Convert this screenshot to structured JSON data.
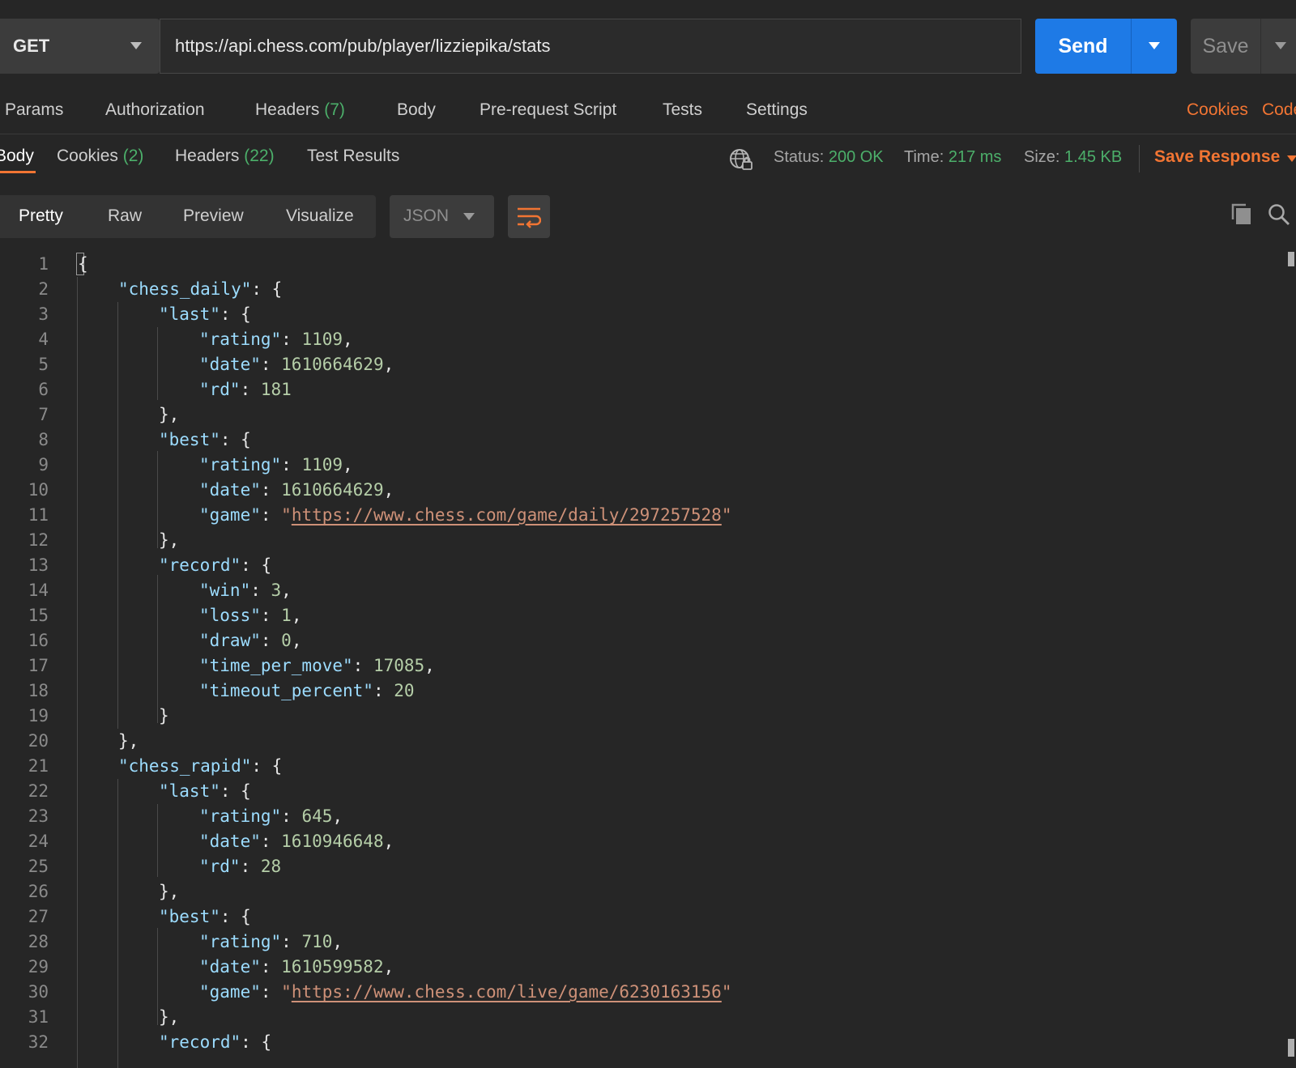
{
  "request": {
    "method": "GET",
    "url": "https://api.chess.com/pub/player/lizziepika/stats",
    "send_label": "Send",
    "save_label": "Save"
  },
  "request_tabs": {
    "params": "Params",
    "authorization": "Authorization",
    "headers": "Headers",
    "headers_count": "(7)",
    "body": "Body",
    "prerequest": "Pre-request Script",
    "tests": "Tests",
    "settings": "Settings",
    "cookies": "Cookies",
    "code": "Code"
  },
  "response_tabs": {
    "body": "Body",
    "cookies": "Cookies",
    "cookies_count": "(2)",
    "headers": "Headers",
    "headers_count": "(22)",
    "test_results": "Test Results"
  },
  "response_meta": {
    "status_label": "Status:",
    "status_value": "200 OK",
    "time_label": "Time:",
    "time_value": "217 ms",
    "size_label": "Size:",
    "size_value": "1.45 KB",
    "save_response": "Save Response"
  },
  "view": {
    "pretty": "Pretty",
    "raw": "Raw",
    "preview": "Preview",
    "visualize": "Visualize",
    "format": "JSON"
  },
  "code_lines": [
    {
      "n": "1",
      "indent": 0,
      "parts": [
        [
          "p",
          "{"
        ]
      ]
    },
    {
      "n": "2",
      "indent": 1,
      "parts": [
        [
          "k",
          "\"chess_daily\""
        ],
        [
          "p",
          ": {"
        ]
      ]
    },
    {
      "n": "3",
      "indent": 2,
      "parts": [
        [
          "k",
          "\"last\""
        ],
        [
          "p",
          ": {"
        ]
      ]
    },
    {
      "n": "4",
      "indent": 3,
      "parts": [
        [
          "k",
          "\"rating\""
        ],
        [
          "p",
          ": "
        ],
        [
          "n",
          "1109"
        ],
        [
          "p",
          ","
        ]
      ]
    },
    {
      "n": "5",
      "indent": 3,
      "parts": [
        [
          "k",
          "\"date\""
        ],
        [
          "p",
          ": "
        ],
        [
          "n",
          "1610664629"
        ],
        [
          "p",
          ","
        ]
      ]
    },
    {
      "n": "6",
      "indent": 3,
      "parts": [
        [
          "k",
          "\"rd\""
        ],
        [
          "p",
          ": "
        ],
        [
          "n",
          "181"
        ]
      ]
    },
    {
      "n": "7",
      "indent": 2,
      "parts": [
        [
          "p",
          "},"
        ]
      ]
    },
    {
      "n": "8",
      "indent": 2,
      "parts": [
        [
          "k",
          "\"best\""
        ],
        [
          "p",
          ": {"
        ]
      ]
    },
    {
      "n": "9",
      "indent": 3,
      "parts": [
        [
          "k",
          "\"rating\""
        ],
        [
          "p",
          ": "
        ],
        [
          "n",
          "1109"
        ],
        [
          "p",
          ","
        ]
      ]
    },
    {
      "n": "10",
      "indent": 3,
      "parts": [
        [
          "k",
          "\"date\""
        ],
        [
          "p",
          ": "
        ],
        [
          "n",
          "1610664629"
        ],
        [
          "p",
          ","
        ]
      ]
    },
    {
      "n": "11",
      "indent": 3,
      "parts": [
        [
          "k",
          "\"game\""
        ],
        [
          "p",
          ": "
        ],
        [
          "s",
          "\""
        ],
        [
          "u",
          "https://www.chess.com/game/daily/297257528"
        ],
        [
          "s",
          "\""
        ]
      ]
    },
    {
      "n": "12",
      "indent": 2,
      "parts": [
        [
          "p",
          "},"
        ]
      ]
    },
    {
      "n": "13",
      "indent": 2,
      "parts": [
        [
          "k",
          "\"record\""
        ],
        [
          "p",
          ": {"
        ]
      ]
    },
    {
      "n": "14",
      "indent": 3,
      "parts": [
        [
          "k",
          "\"win\""
        ],
        [
          "p",
          ": "
        ],
        [
          "n",
          "3"
        ],
        [
          "p",
          ","
        ]
      ]
    },
    {
      "n": "15",
      "indent": 3,
      "parts": [
        [
          "k",
          "\"loss\""
        ],
        [
          "p",
          ": "
        ],
        [
          "n",
          "1"
        ],
        [
          "p",
          ","
        ]
      ]
    },
    {
      "n": "16",
      "indent": 3,
      "parts": [
        [
          "k",
          "\"draw\""
        ],
        [
          "p",
          ": "
        ],
        [
          "n",
          "0"
        ],
        [
          "p",
          ","
        ]
      ]
    },
    {
      "n": "17",
      "indent": 3,
      "parts": [
        [
          "k",
          "\"time_per_move\""
        ],
        [
          "p",
          ": "
        ],
        [
          "n",
          "17085"
        ],
        [
          "p",
          ","
        ]
      ]
    },
    {
      "n": "18",
      "indent": 3,
      "parts": [
        [
          "k",
          "\"timeout_percent\""
        ],
        [
          "p",
          ": "
        ],
        [
          "n",
          "20"
        ]
      ]
    },
    {
      "n": "19",
      "indent": 2,
      "parts": [
        [
          "p",
          "}"
        ]
      ]
    },
    {
      "n": "20",
      "indent": 1,
      "parts": [
        [
          "p",
          "},"
        ]
      ]
    },
    {
      "n": "21",
      "indent": 1,
      "parts": [
        [
          "k",
          "\"chess_rapid\""
        ],
        [
          "p",
          ": {"
        ]
      ]
    },
    {
      "n": "22",
      "indent": 2,
      "parts": [
        [
          "k",
          "\"last\""
        ],
        [
          "p",
          ": {"
        ]
      ]
    },
    {
      "n": "23",
      "indent": 3,
      "parts": [
        [
          "k",
          "\"rating\""
        ],
        [
          "p",
          ": "
        ],
        [
          "n",
          "645"
        ],
        [
          "p",
          ","
        ]
      ]
    },
    {
      "n": "24",
      "indent": 3,
      "parts": [
        [
          "k",
          "\"date\""
        ],
        [
          "p",
          ": "
        ],
        [
          "n",
          "1610946648"
        ],
        [
          "p",
          ","
        ]
      ]
    },
    {
      "n": "25",
      "indent": 3,
      "parts": [
        [
          "k",
          "\"rd\""
        ],
        [
          "p",
          ": "
        ],
        [
          "n",
          "28"
        ]
      ]
    },
    {
      "n": "26",
      "indent": 2,
      "parts": [
        [
          "p",
          "},"
        ]
      ]
    },
    {
      "n": "27",
      "indent": 2,
      "parts": [
        [
          "k",
          "\"best\""
        ],
        [
          "p",
          ": {"
        ]
      ]
    },
    {
      "n": "28",
      "indent": 3,
      "parts": [
        [
          "k",
          "\"rating\""
        ],
        [
          "p",
          ": "
        ],
        [
          "n",
          "710"
        ],
        [
          "p",
          ","
        ]
      ]
    },
    {
      "n": "29",
      "indent": 3,
      "parts": [
        [
          "k",
          "\"date\""
        ],
        [
          "p",
          ": "
        ],
        [
          "n",
          "1610599582"
        ],
        [
          "p",
          ","
        ]
      ]
    },
    {
      "n": "30",
      "indent": 3,
      "parts": [
        [
          "k",
          "\"game\""
        ],
        [
          "p",
          ": "
        ],
        [
          "s",
          "\""
        ],
        [
          "u",
          "https://www.chess.com/live/game/6230163156"
        ],
        [
          "s",
          "\""
        ]
      ]
    },
    {
      "n": "31",
      "indent": 2,
      "parts": [
        [
          "p",
          "},"
        ]
      ]
    },
    {
      "n": "32",
      "indent": 2,
      "parts": [
        [
          "k",
          "\"record\""
        ],
        [
          "p",
          ": {"
        ]
      ]
    }
  ],
  "icons": {
    "globe": "globe-lock-icon",
    "wrap": "word-wrap-icon",
    "copy": "copy-icon",
    "search": "search-icon"
  },
  "colors": {
    "accent": "#f27533",
    "send": "#1e7ae6",
    "success": "#4caf6a"
  }
}
